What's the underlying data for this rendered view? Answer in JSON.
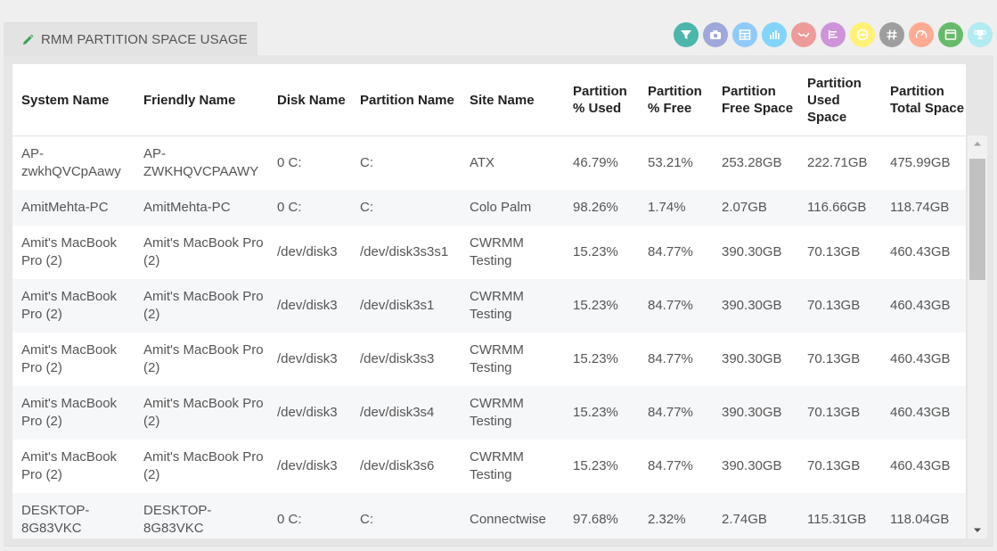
{
  "tab": {
    "title": "RMM PARTITION SPACE USAGE",
    "icon": "pencil-icon"
  },
  "toolbar": [
    {
      "name": "filter-icon",
      "color": "#4db6ac"
    },
    {
      "name": "camera-icon",
      "color": "#9fa8da"
    },
    {
      "name": "table-icon",
      "color": "#90caf9"
    },
    {
      "name": "bar-chart-icon",
      "color": "#81d4fa"
    },
    {
      "name": "line-chart-icon",
      "color": "#ef9a9a"
    },
    {
      "name": "list-icon",
      "color": "#ce93d8"
    },
    {
      "name": "steering-icon",
      "color": "#fff176"
    },
    {
      "name": "hash-icon",
      "color": "#9e9e9e"
    },
    {
      "name": "gauge-icon",
      "color": "#ffab91"
    },
    {
      "name": "window-icon",
      "color": "#66bb6a"
    },
    {
      "name": "trophy-icon",
      "color": "#b2ebf2"
    }
  ],
  "table": {
    "headers": [
      "System Name",
      "Friendly Name",
      "Disk Name",
      "Partition Name",
      "Site Name",
      "Partition % Used",
      "Partition % Free",
      "Partition Free Space",
      "Partition Used Space",
      "Partition Total Space"
    ],
    "rows": [
      [
        "AP-zwkhQVCpAawy",
        "AP-ZWKHQVCPAAWY",
        "0 C:",
        "C:",
        "ATX",
        "46.79%",
        "53.21%",
        "253.28GB",
        "222.71GB",
        "475.99GB"
      ],
      [
        "AmitMehta-PC",
        "AmitMehta-PC",
        "0 C:",
        "C:",
        "Colo Palm",
        "98.26%",
        "1.74%",
        "2.07GB",
        "116.66GB",
        "118.74GB"
      ],
      [
        "Amit's MacBook Pro (2)",
        "Amit's MacBook Pro (2)",
        "/dev/disk3",
        "/dev/disk3s3s1",
        "CWRMM Testing",
        "15.23%",
        "84.77%",
        "390.30GB",
        "70.13GB",
        "460.43GB"
      ],
      [
        "Amit's MacBook Pro (2)",
        "Amit's MacBook Pro (2)",
        "/dev/disk3",
        "/dev/disk3s1",
        "CWRMM Testing",
        "15.23%",
        "84.77%",
        "390.30GB",
        "70.13GB",
        "460.43GB"
      ],
      [
        "Amit's MacBook Pro (2)",
        "Amit's MacBook Pro (2)",
        "/dev/disk3",
        "/dev/disk3s3",
        "CWRMM Testing",
        "15.23%",
        "84.77%",
        "390.30GB",
        "70.13GB",
        "460.43GB"
      ],
      [
        "Amit's MacBook Pro (2)",
        "Amit's MacBook Pro (2)",
        "/dev/disk3",
        "/dev/disk3s4",
        "CWRMM Testing",
        "15.23%",
        "84.77%",
        "390.30GB",
        "70.13GB",
        "460.43GB"
      ],
      [
        "Amit's MacBook Pro (2)",
        "Amit's MacBook Pro (2)",
        "/dev/disk3",
        "/dev/disk3s6",
        "CWRMM Testing",
        "15.23%",
        "84.77%",
        "390.30GB",
        "70.13GB",
        "460.43GB"
      ],
      [
        "DESKTOP-8G83VKC",
        "DESKTOP-8G83VKC",
        "0 C:",
        "C:",
        "Connectwise",
        "97.68%",
        "2.32%",
        "2.74GB",
        "115.31GB",
        "118.04GB"
      ]
    ]
  }
}
